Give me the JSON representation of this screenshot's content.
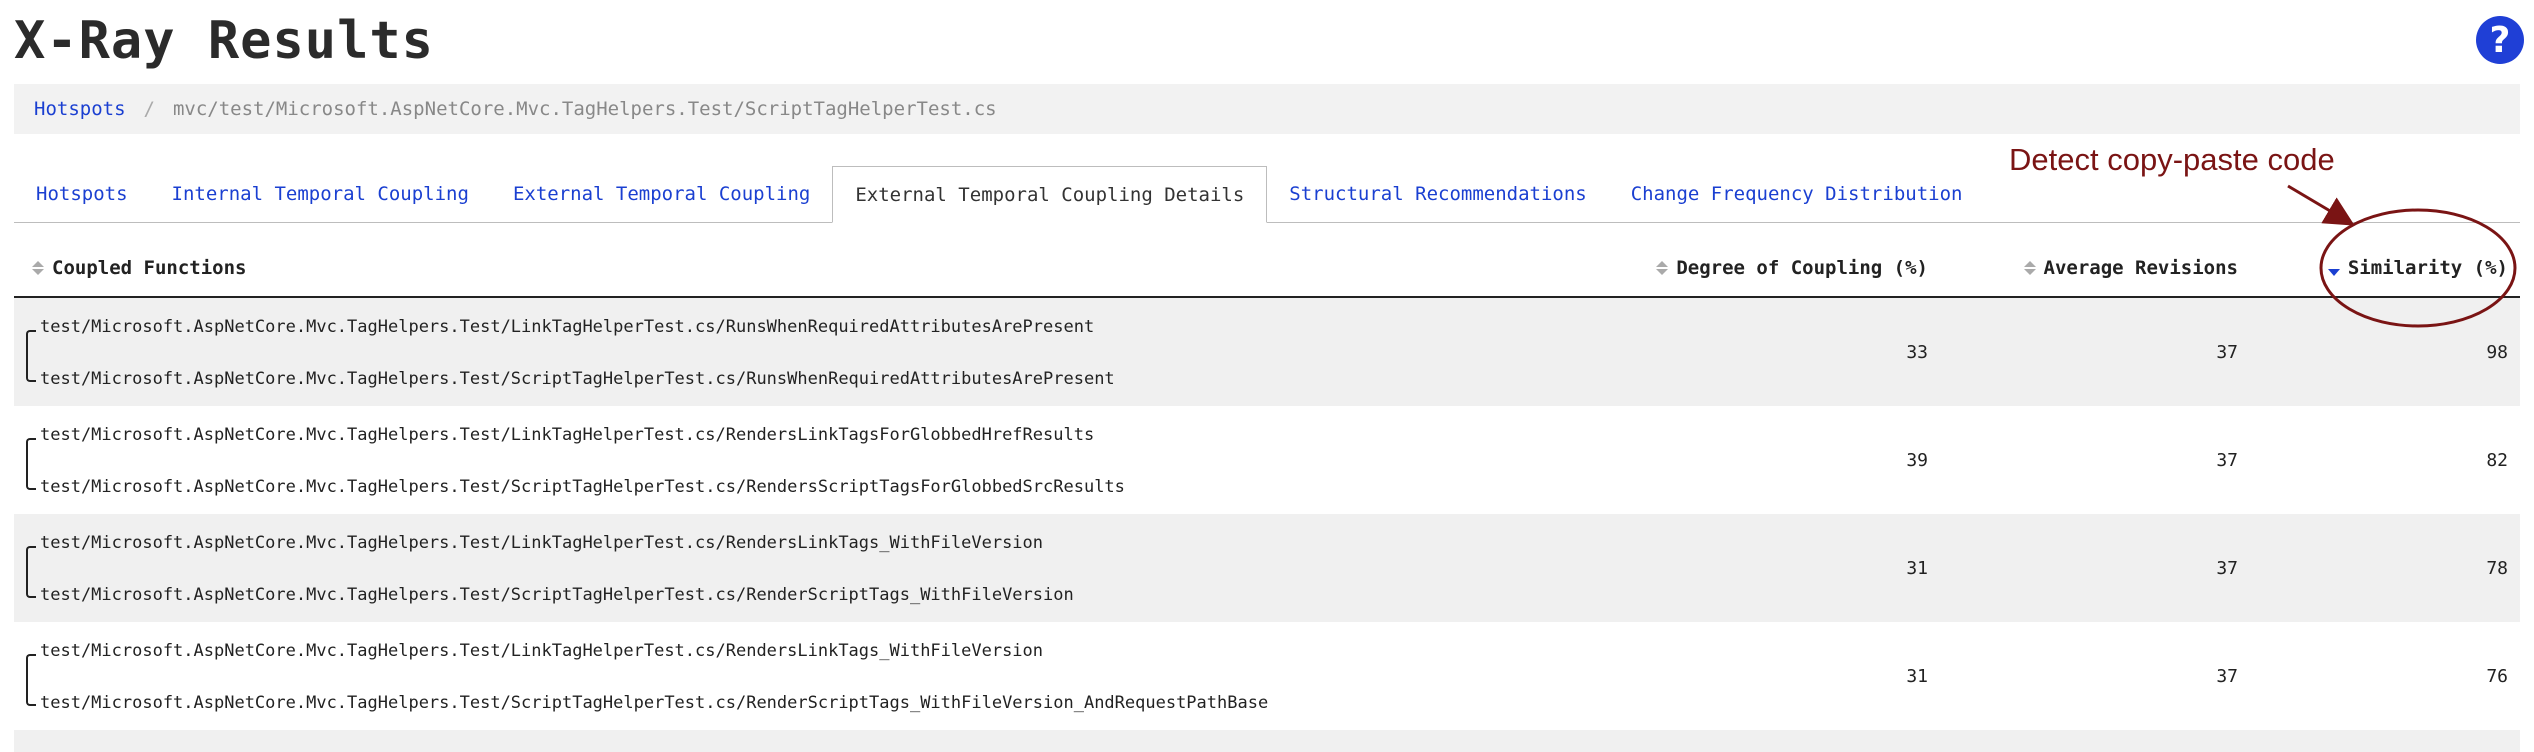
{
  "page": {
    "title": "X-Ray Results"
  },
  "help": {
    "symbol": "?"
  },
  "breadcrumb": {
    "root": "Hotspots",
    "separator": "/",
    "current": "mvc/test/Microsoft.AspNetCore.Mvc.TagHelpers.Test/ScriptTagHelperTest.cs"
  },
  "tabs": [
    {
      "label": "Hotspots"
    },
    {
      "label": "Internal Temporal Coupling"
    },
    {
      "label": "External Temporal Coupling"
    },
    {
      "label": "External Temporal Coupling Details"
    },
    {
      "label": "Structural Recommendations"
    },
    {
      "label": "Change Frequency Distribution"
    }
  ],
  "annotation": {
    "text": "Detect copy-paste code",
    "color": "#7a1414"
  },
  "table": {
    "headers": {
      "functions": "Coupled Functions",
      "coupling": "Degree of Coupling (%)",
      "revisions": "Average Revisions",
      "similarity": "Similarity (%)"
    },
    "rows": [
      {
        "f1": "test/Microsoft.AspNetCore.Mvc.TagHelpers.Test/LinkTagHelperTest.cs/RunsWhenRequiredAttributesArePresent",
        "f2": "test/Microsoft.AspNetCore.Mvc.TagHelpers.Test/ScriptTagHelperTest.cs/RunsWhenRequiredAttributesArePresent",
        "coupling": "33",
        "revisions": "37",
        "similarity": "98"
      },
      {
        "f1": "test/Microsoft.AspNetCore.Mvc.TagHelpers.Test/LinkTagHelperTest.cs/RendersLinkTagsForGlobbedHrefResults",
        "f2": "test/Microsoft.AspNetCore.Mvc.TagHelpers.Test/ScriptTagHelperTest.cs/RendersScriptTagsForGlobbedSrcResults",
        "coupling": "39",
        "revisions": "37",
        "similarity": "82"
      },
      {
        "f1": "test/Microsoft.AspNetCore.Mvc.TagHelpers.Test/LinkTagHelperTest.cs/RendersLinkTags_WithFileVersion",
        "f2": "test/Microsoft.AspNetCore.Mvc.TagHelpers.Test/ScriptTagHelperTest.cs/RenderScriptTags_WithFileVersion",
        "coupling": "31",
        "revisions": "37",
        "similarity": "78"
      },
      {
        "f1": "test/Microsoft.AspNetCore.Mvc.TagHelpers.Test/LinkTagHelperTest.cs/RendersLinkTags_WithFileVersion",
        "f2": "test/Microsoft.AspNetCore.Mvc.TagHelpers.Test/ScriptTagHelperTest.cs/RenderScriptTags_WithFileVersion_AndRequestPathBase",
        "coupling": "31",
        "revisions": "37",
        "similarity": "76"
      }
    ]
  }
}
